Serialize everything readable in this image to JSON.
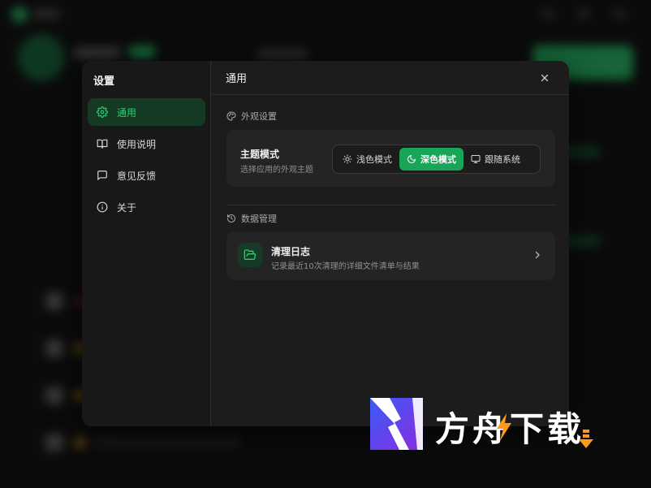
{
  "settings": {
    "title": "设置",
    "nav": [
      {
        "label": "通用",
        "icon": "gear-icon",
        "active": true
      },
      {
        "label": "使用说明",
        "icon": "book-icon",
        "active": false
      },
      {
        "label": "意见反馈",
        "icon": "message-icon",
        "active": false
      },
      {
        "label": "关于",
        "icon": "info-icon",
        "active": false
      }
    ]
  },
  "main": {
    "title": "通用",
    "appearance": {
      "section_label": "外观设置",
      "theme_title": "主题模式",
      "theme_subtitle": "选择应用的外观主题",
      "options": [
        {
          "label": "浅色模式",
          "icon": "sun-icon",
          "selected": false
        },
        {
          "label": "深色模式",
          "icon": "moon-icon",
          "selected": true
        },
        {
          "label": "跟随系统",
          "icon": "monitor-icon",
          "selected": false
        }
      ]
    },
    "data": {
      "section_label": "数据管理",
      "clean_log_title": "清理日志",
      "clean_log_subtitle": "记录最近10次清理的详细文件清单与结果"
    }
  },
  "watermark": {
    "text": "方舟下载"
  },
  "colors": {
    "accent": "#19a558",
    "accent_text": "#2ad06f",
    "dialog_bg": "#1c1c1c",
    "card_bg": "#242424"
  }
}
